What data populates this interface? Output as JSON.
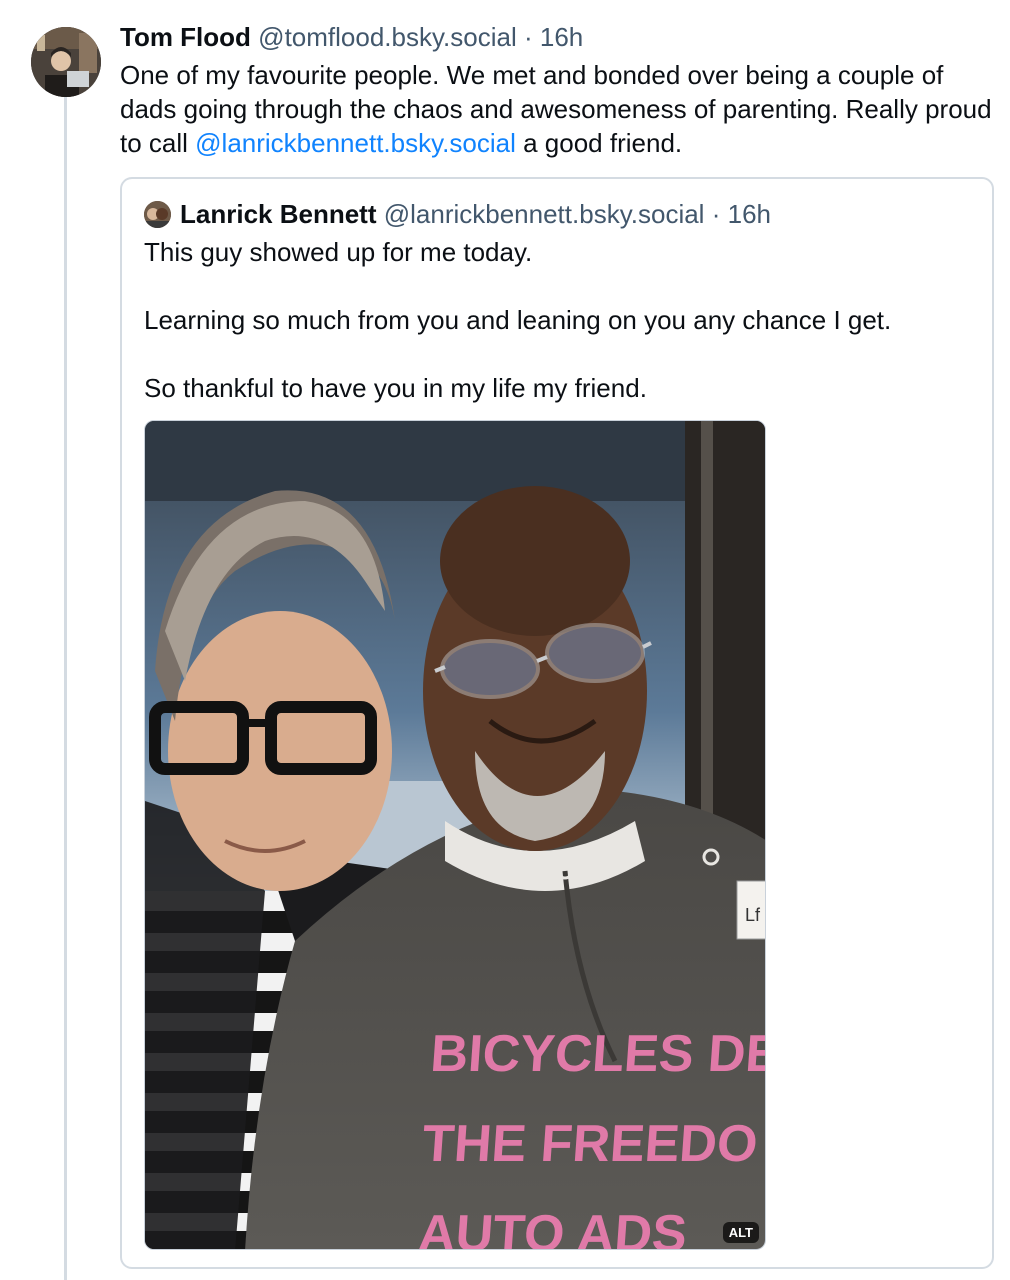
{
  "post": {
    "author_name": "Tom Flood",
    "author_handle": "@tomflood.bsky.social",
    "separator": "·",
    "time": "16h",
    "text_before": "One of my favourite people. We met and bonded over being a couple of dads going through the chaos and awesomeness of parenting. Really proud to call ",
    "mention": "@lanrickbennett.bsky.social",
    "text_after": " a good friend."
  },
  "quote": {
    "author_name": "Lanrick Bennett",
    "author_handle": "@lanrickbennett.bsky.social",
    "separator": "·",
    "time": "16h",
    "lines": [
      "This guy showed up for me today.",
      "",
      "Learning so much from you and leaning on you any chance I get.",
      "",
      "So thankful to have you in my life my friend."
    ],
    "image": {
      "alt_badge": "ALT",
      "shirt_text_line1": "BICYCLES DE",
      "shirt_text_line2": "THE FREEDO",
      "shirt_text_line3": "AUTO ADS",
      "name_tag_text": "Lf"
    }
  },
  "colors": {
    "link": "#1083fe",
    "muted": "#42576c",
    "border": "#d4dbe2",
    "shirt_print": "#e07aa8"
  }
}
